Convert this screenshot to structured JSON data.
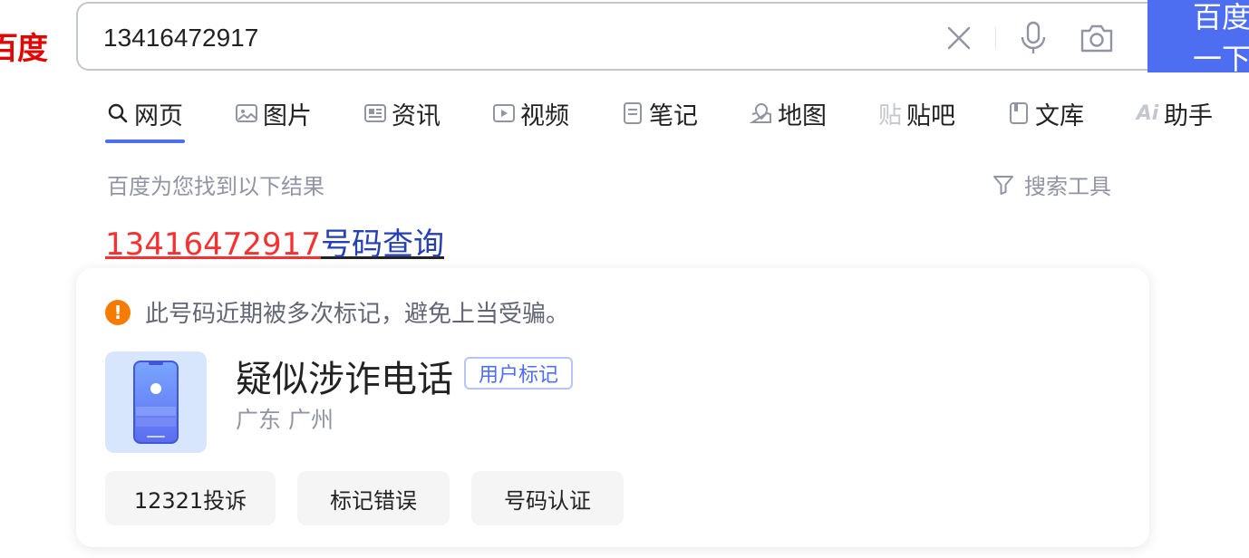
{
  "logo": {
    "text": "百度"
  },
  "search": {
    "query": "13416472917",
    "button_label": "百度一下"
  },
  "icons": {
    "clear": "close-icon",
    "mic": "microphone-icon",
    "camera": "camera-icon"
  },
  "tabs": [
    {
      "label": "网页",
      "icon": "search-icon",
      "active": true
    },
    {
      "label": "图片",
      "icon": "image-icon"
    },
    {
      "label": "资讯",
      "icon": "news-icon"
    },
    {
      "label": "视频",
      "icon": "video-icon"
    },
    {
      "label": "笔记",
      "icon": "note-icon"
    },
    {
      "label": "地图",
      "icon": "map-icon"
    },
    {
      "label": "贴吧",
      "icon": "tieba-icon"
    },
    {
      "label": "文库",
      "icon": "document-icon"
    },
    {
      "label": "助手",
      "icon": "ai-icon"
    }
  ],
  "results_header": {
    "count_text": "百度为您找到以下结果",
    "tools_label": "搜索工具"
  },
  "result": {
    "title_highlight": "13416472917",
    "title_rest": "号码查询",
    "warning": "此号码近期被多次标记，避免上当受骗。",
    "verdict": "疑似涉诈电话",
    "badge": "用户标记",
    "location": "广东 广州",
    "actions": [
      "12321投诉",
      "标记错误",
      "号码认证"
    ]
  },
  "colors": {
    "brand_blue": "#4e6ef2",
    "logo_red": "#e10602",
    "highlight_red": "#f73131",
    "link_blue": "#2440b3",
    "warning_orange": "#f57c00"
  }
}
